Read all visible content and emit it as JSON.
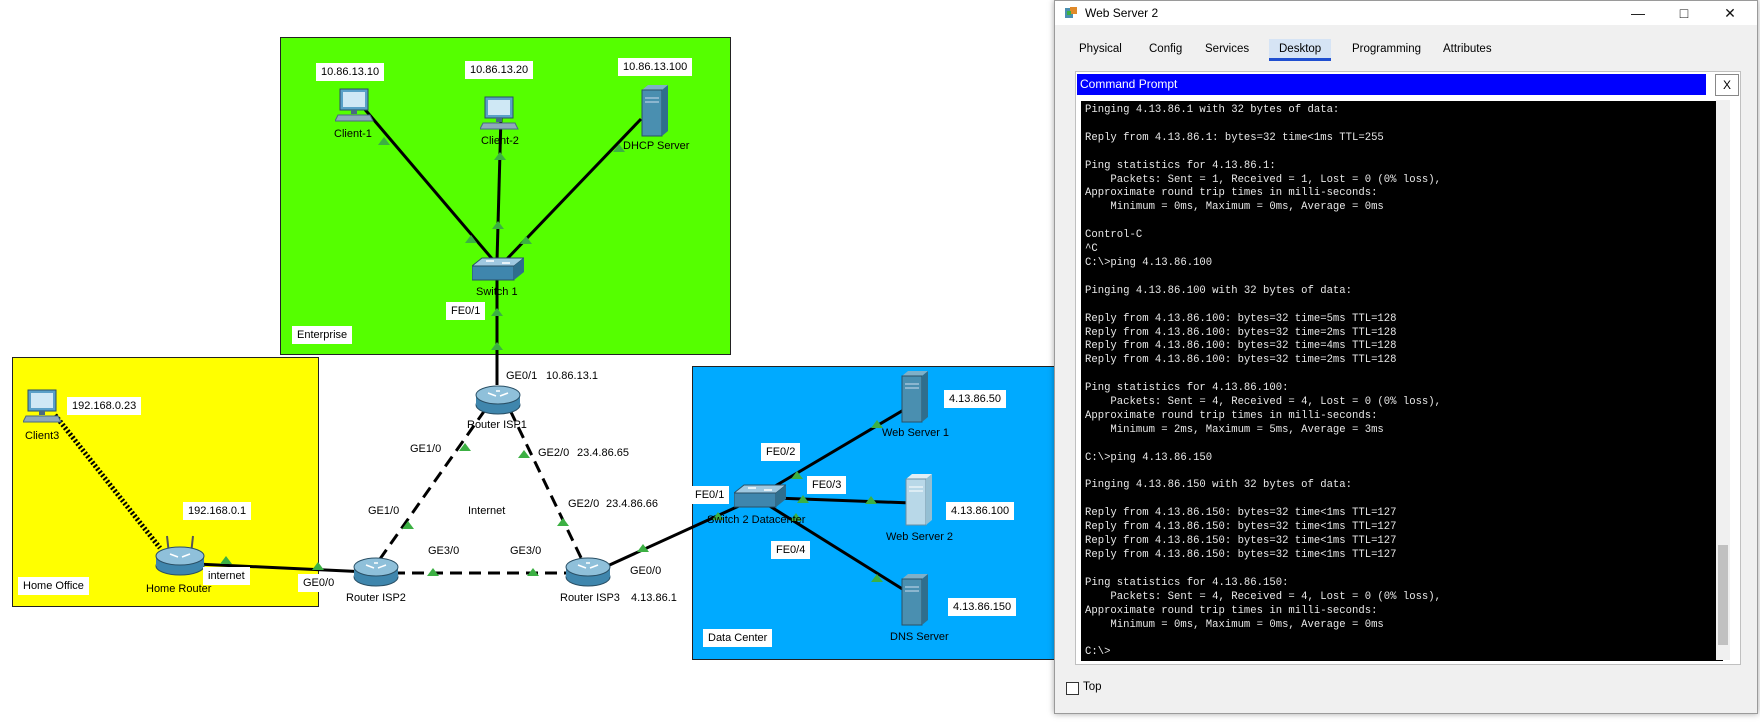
{
  "zones": {
    "enterprise": "Enterprise",
    "home_office": "Home Office",
    "data_center": "Data Center"
  },
  "devices": {
    "client1": {
      "name": "Client-1",
      "ip": "10.86.13.10"
    },
    "client2": {
      "name": "Client-2",
      "ip": "10.86.13.20"
    },
    "dhcp": {
      "name": "DHCP Server",
      "ip": "10.86.13.100"
    },
    "switch1": {
      "name": "Switch 1"
    },
    "router_isp1": {
      "name": "Router ISP1",
      "ip": "10.86.13.1"
    },
    "router_isp2": {
      "name": "Router ISP2"
    },
    "router_isp3": {
      "name": "Router ISP3",
      "ip": "4.13.86.1"
    },
    "client3": {
      "name": "Client3",
      "ip": "192.168.0.23"
    },
    "home_router": {
      "name": "Home Router",
      "ip": "192.168.0.1"
    },
    "switch2": {
      "name": "Switch 2 Datacenter"
    },
    "web1": {
      "name": "Web Server 1",
      "ip": "4.13.86.50"
    },
    "web2": {
      "name": "Web Server 2",
      "ip": "4.13.86.100"
    },
    "dns": {
      "name": "DNS Server",
      "ip": "4.13.86.150"
    }
  },
  "ports": {
    "fe01_sw1": "FE0/1",
    "ge01_r1": "GE0/1",
    "ge10_r1": "GE1/0",
    "ge20_r1": "GE2/0",
    "ge20_r1_ip": "23.4.86.65",
    "ge10_r2": "GE1/0",
    "ge20_r3": "GE2/0",
    "ge20_r3_ip": "23.4.86.66",
    "ge30_r2": "GE3/0",
    "ge30_r3": "GE3/0",
    "ge00_r2": "GE0/0",
    "ge00_r3": "GE0/0",
    "internet_home": "internet",
    "internet_cloud": "Internet",
    "fe01_sw2": "FE0/1",
    "fe02_sw2": "FE0/2",
    "fe03_sw2": "FE0/3",
    "fe04_sw2": "FE0/4"
  },
  "window": {
    "title": "Web Server 2",
    "tabs": [
      "Physical",
      "Config",
      "Services",
      "Desktop",
      "Programming",
      "Attributes"
    ],
    "active_tab": "Desktop",
    "command_prompt_title": "Command Prompt",
    "close_x": "X",
    "console": "Pinging 4.13.86.1 with 32 bytes of data:\n\nReply from 4.13.86.1: bytes=32 time<1ms TTL=255\n\nPing statistics for 4.13.86.1:\n    Packets: Sent = 1, Received = 1, Lost = 0 (0% loss),\nApproximate round trip times in milli-seconds:\n    Minimum = 0ms, Maximum = 0ms, Average = 0ms\n\nControl-C\n^C\nC:\\>ping 4.13.86.100\n\nPinging 4.13.86.100 with 32 bytes of data:\n\nReply from 4.13.86.100: bytes=32 time=5ms TTL=128\nReply from 4.13.86.100: bytes=32 time=2ms TTL=128\nReply from 4.13.86.100: bytes=32 time=4ms TTL=128\nReply from 4.13.86.100: bytes=32 time=2ms TTL=128\n\nPing statistics for 4.13.86.100:\n    Packets: Sent = 4, Received = 4, Lost = 0 (0% loss),\nApproximate round trip times in milli-seconds:\n    Minimum = 2ms, Maximum = 5ms, Average = 3ms\n\nC:\\>ping 4.13.86.150\n\nPinging 4.13.86.150 with 32 bytes of data:\n\nReply from 4.13.86.150: bytes=32 time<1ms TTL=127\nReply from 4.13.86.150: bytes=32 time<1ms TTL=127\nReply from 4.13.86.150: bytes=32 time<1ms TTL=127\nReply from 4.13.86.150: bytes=32 time<1ms TTL=127\n\nPing statistics for 4.13.86.150:\n    Packets: Sent = 4, Received = 4, Lost = 0 (0% loss),\nApproximate round trip times in milli-seconds:\n    Minimum = 0ms, Maximum = 0ms, Average = 0ms\n\nC:\\>",
    "top_checkbox_label": "Top"
  },
  "colors": {
    "enterprise": "#55ff00",
    "home_office": "#ffff00",
    "data_center": "#00aaff",
    "link_indicator": "#3cb043",
    "cmd_bar": "#0000ff"
  }
}
